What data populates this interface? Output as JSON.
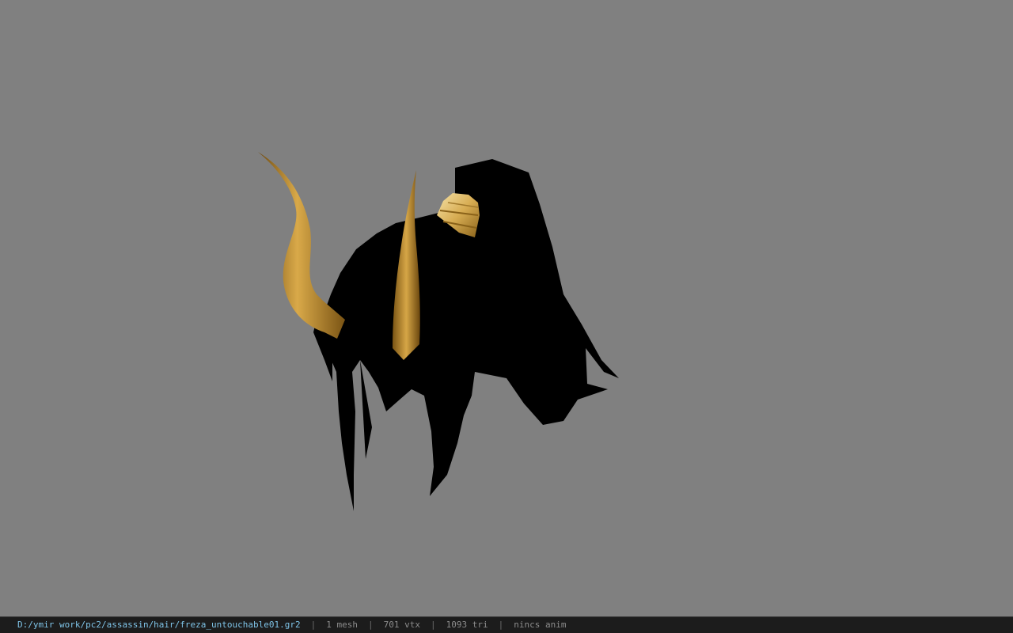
{
  "viewport": {
    "background_color": "#808080",
    "model_name": "hair mesh with golden horns"
  },
  "status_bar": {
    "file_path": "D:/ymir work/pc2/assassin/hair/freza_untouchable01.gr2",
    "separator": "|",
    "mesh_count": "1 mesh",
    "vertex_count": "701 vtx",
    "triangle_count": "1093 tri",
    "anim_status": "nincs anim"
  },
  "colors": {
    "path_text": "#7fc4e8",
    "stat_text": "#8c8c8c",
    "status_bar_bg": "#1c1c1c",
    "hair": "#000000",
    "horn_gold": "#b8862a"
  }
}
